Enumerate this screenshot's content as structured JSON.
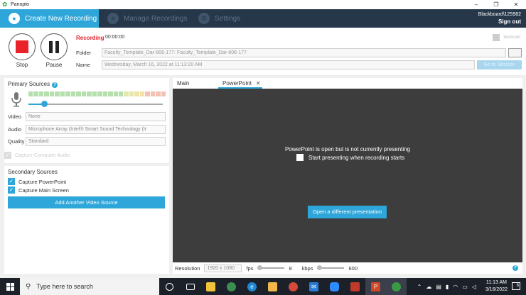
{
  "window": {
    "title": "Panopto",
    "controls": [
      "–",
      "❐",
      "✕"
    ]
  },
  "nav": {
    "tabs": [
      {
        "label": "Create New Recording",
        "icon": "record-icon",
        "active": true
      },
      {
        "label": "Manage Recordings",
        "icon": "list-icon",
        "active": false
      },
      {
        "label": "Settings",
        "icon": "gear-icon",
        "active": false
      }
    ],
    "user": "Blackboard\\125982",
    "signout": "Sign out"
  },
  "controls": {
    "stop_label": "Stop",
    "pause_label": "Pause",
    "recording_label": "Recording",
    "recording_time": "00:00:00",
    "webcam_label": "Webcam",
    "folder_label": "Folder",
    "folder_value": "Faculty_Template_Dar-806-177: Faculty_Template_Dar-806-177",
    "name_label": "Name",
    "name_value": "Wednesday, March 16, 2022 at 11:13:20 AM",
    "go_button": "Go to Session"
  },
  "primary": {
    "title": "Primary Sources",
    "video_label": "Video",
    "video_value": "None",
    "audio_label": "Audio",
    "audio_value": "Microphone Array (Intel® Smart Sound Technology (Ir",
    "quality_label": "Quality",
    "quality_value": "Standard",
    "capture_computer": "Capture Computer Audio",
    "audio_level": 0.12,
    "meter_colors": [
      "#b6dfae",
      "#b6dfae",
      "#b6dfae",
      "#b6dfae",
      "#b6dfae",
      "#b6dfae",
      "#b6dfae",
      "#b6dfae",
      "#b6dfae",
      "#b6dfae",
      "#b6dfae",
      "#b6dfae",
      "#b6dfae",
      "#b6dfae",
      "#b6dfae",
      "#b6dfae",
      "#b6dfae",
      "#b6dfae",
      "#e3e9ad",
      "#e3e9ad",
      "#f3e2a6",
      "#f3e2a6",
      "#f3c1b5",
      "#f3c1b5",
      "#f3c1b5",
      "#f3c1b5"
    ]
  },
  "secondary": {
    "title": "Secondary Sources",
    "items": [
      {
        "label": "Capture PowerPoint",
        "checked": true
      },
      {
        "label": "Capture Main Screen",
        "checked": true
      }
    ],
    "add_button": "Add Another Video Source"
  },
  "preview": {
    "tabs": [
      {
        "label": "Main Screen",
        "active": false
      },
      {
        "label": "PowerPoint",
        "active": true
      }
    ],
    "message": "PowerPoint is open but is not currently presenting",
    "checkbox_label": "Start presenting when recording starts",
    "open_button": "Open a different presentation",
    "resolution_label": "Resolution",
    "resolution_value": "1920 x 1080",
    "fps_label": "fps",
    "fps_value": "8",
    "kbps_label": "kbps",
    "kbps_value": "600"
  },
  "taskbar": {
    "search_placeholder": "Type here to search",
    "time": "11:13 AM",
    "date": "3/16/2022",
    "notifications": "6"
  }
}
